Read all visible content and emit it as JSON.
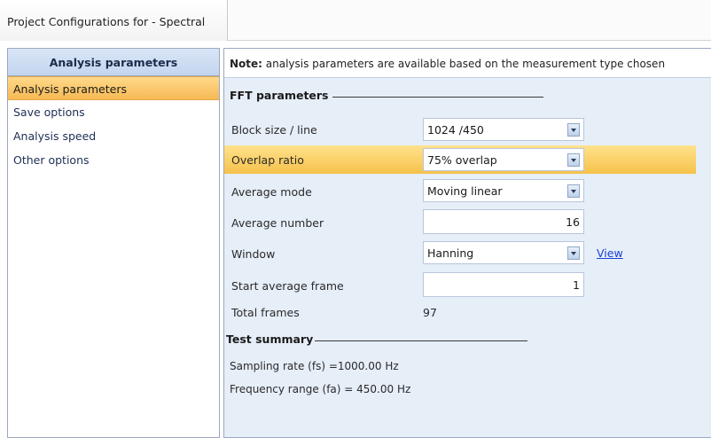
{
  "window": {
    "title": "Project Configurations for - Spectral"
  },
  "left_panel": {
    "header": "Analysis parameters",
    "items": [
      {
        "label": "Analysis parameters"
      },
      {
        "label": "Save options"
      },
      {
        "label": "Analysis speed"
      },
      {
        "label": "Other options"
      }
    ]
  },
  "note": {
    "bold": "Note:",
    "text": " analysis parameters are available based on the measurement type chosen"
  },
  "fft": {
    "title": "FFT parameters",
    "block_size": {
      "label": "Block size / line",
      "value": "1024 /450"
    },
    "overlap": {
      "label": "Overlap ratio",
      "value": "75% overlap"
    },
    "avg_mode": {
      "label": "Average mode",
      "value": "Moving linear"
    },
    "avg_number": {
      "label": "Average number",
      "value": "16"
    },
    "window": {
      "label": "Window",
      "value": "Hanning",
      "link": "View"
    },
    "start_frame": {
      "label": "Start average frame",
      "value": "1"
    },
    "total_frames": {
      "label": "Total frames",
      "value": "97"
    }
  },
  "summary": {
    "title": "Test summary",
    "sampling": "Sampling rate (fs) =1000.00 Hz",
    "frequency": "Frequency range (fa) = 450.00 Hz"
  }
}
